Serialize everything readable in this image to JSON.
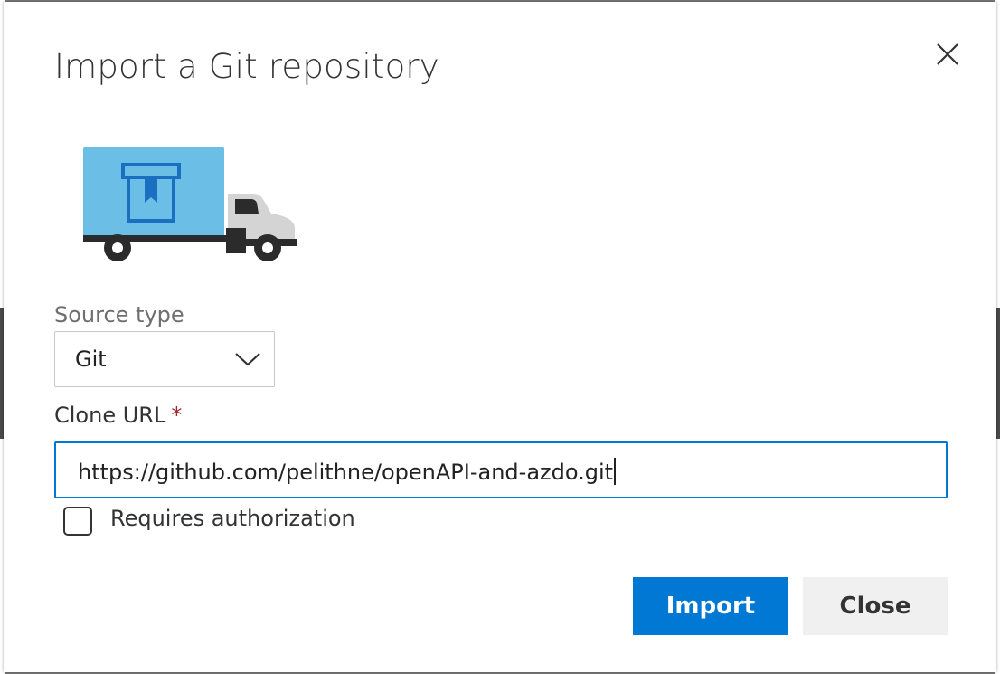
{
  "dialog": {
    "title": "Import a Git repository",
    "close_icon": "close-icon",
    "illustration": "delivery-truck-illustration"
  },
  "form": {
    "source_type": {
      "label": "Source type",
      "selected": "Git",
      "icon": "chevron-down-icon"
    },
    "clone_url": {
      "label": "Clone URL",
      "required_marker": "*",
      "value": "https://github.com/pelithne/openAPI-and-azdo.git"
    },
    "requires_auth": {
      "label": "Requires authorization",
      "checked": false
    }
  },
  "actions": {
    "import_label": "Import",
    "close_label": "Close"
  },
  "colors": {
    "accent": "#0078d4",
    "required": "#a4262c",
    "truck_box": "#6bbfe6"
  }
}
